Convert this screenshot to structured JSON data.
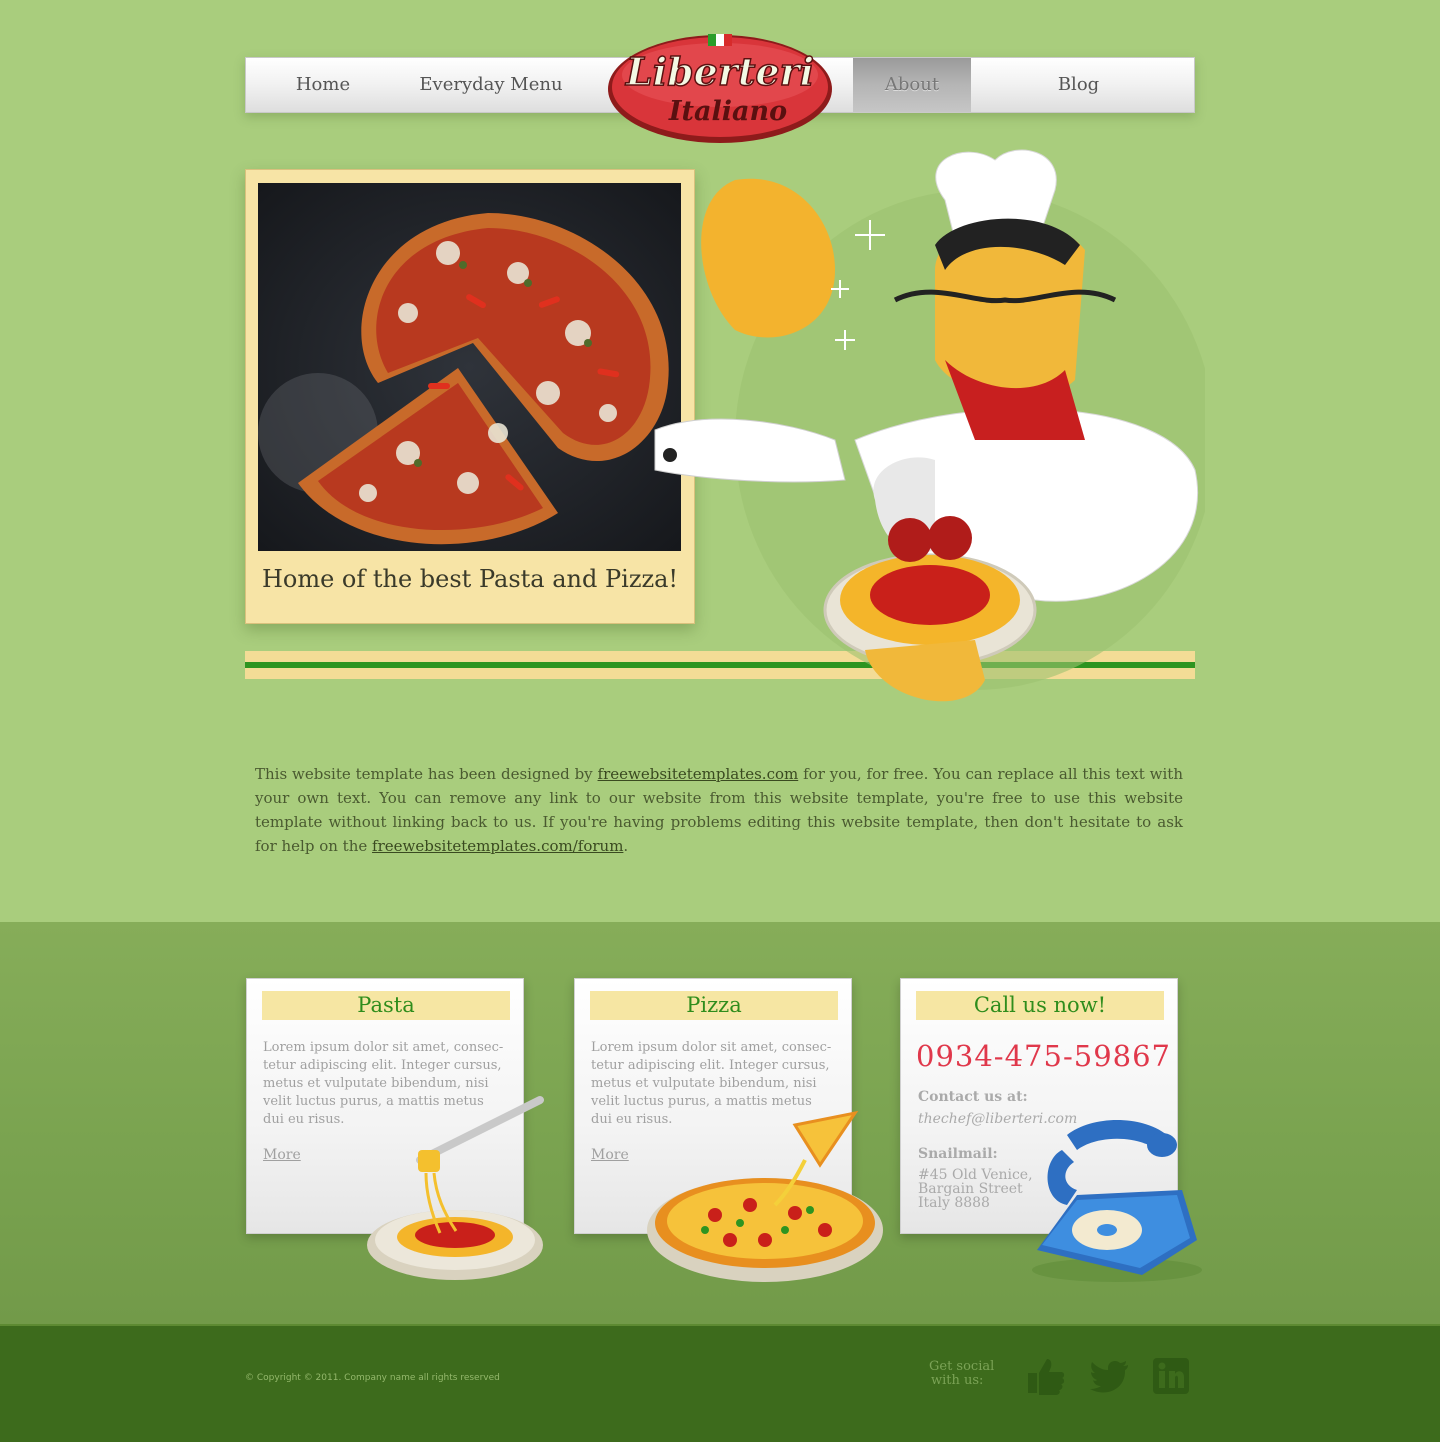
{
  "nav": {
    "items": [
      {
        "label": "Home",
        "active": false
      },
      {
        "label": "Everyday Menu",
        "active": false
      },
      {
        "label": "About",
        "active": true
      },
      {
        "label": "Blog",
        "active": false
      }
    ]
  },
  "logo": {
    "line1": "Liberteri",
    "line2": "Italiano"
  },
  "hero": {
    "caption": "Home of the best Pasta and Pizza!"
  },
  "intro": {
    "part1": "This website template has been designed by ",
    "link1": "freewebsitetemplates.com",
    "part2": " for you, for free. You can replace all this text with your own text. You can remove any link to our website from this website template, you're free to use this website template without linking back to us. If you're having problems editing this website template, then don't hesitate to ask for help on the ",
    "link2": "freewebsitetemplates.com/forum",
    "part3": "."
  },
  "cards": {
    "pasta": {
      "title": "Pasta",
      "text": "Lorem ipsum dolor sit amet, consec-tetur adipiscing elit. Integer cursus, metus et vulputate bibendum, nisi velit luctus purus, a mattis metus dui eu risus.",
      "more": "More"
    },
    "pizza": {
      "title": "Pizza",
      "text": "Lorem ipsum dolor sit amet, consec-tetur adipiscing elit. Integer cursus, metus et vulputate bibendum, nisi velit luctus purus, a mattis metus dui eu risus.",
      "more": "More"
    },
    "call": {
      "title": "Call us now!",
      "phone": "0934-475-59867",
      "contact_label": "Contact us at:",
      "email": "thechef@liberteri.com",
      "snail_label": "Snailmail:",
      "address1": "#45 Old Venice,",
      "address2": "Bargain Street",
      "address3": "Italy 8888"
    }
  },
  "footer": {
    "copyright": "© Copyright © 2011. Company name all rights reserved",
    "social_line1": "Get social",
    "social_line2": "with us:",
    "icons": [
      "facebook-like-icon",
      "twitter-icon",
      "linkedin-icon"
    ]
  },
  "colors": {
    "accent_green": "#2f8d1c",
    "phone_red": "#e0384b",
    "paper": "#f6e6a3"
  }
}
